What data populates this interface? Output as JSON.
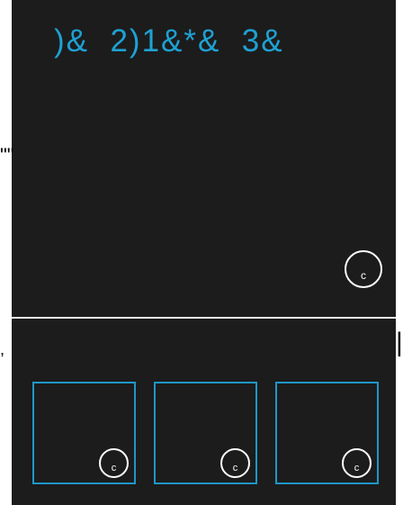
{
  "header": {
    "title": ")&  2)1&*&  3&"
  },
  "edge_marks": {
    "left_top": "\"\"",
    "left_bottom": ",",
    "right_bottom": "|"
  },
  "main_button": {
    "label": "c"
  },
  "tiles": [
    {
      "button_label": "c"
    },
    {
      "button_label": "c"
    },
    {
      "button_label": "c"
    }
  ],
  "colors": {
    "background": "#1c1c1c",
    "accent": "#1ea1d4",
    "tile_border": "#1f97c8",
    "divider": "#e8e8e8"
  }
}
